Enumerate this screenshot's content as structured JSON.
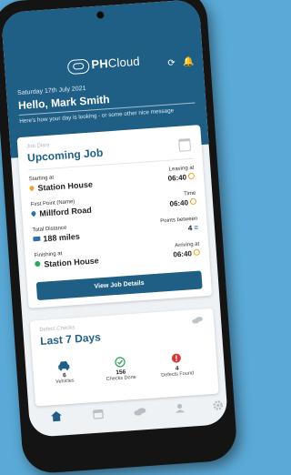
{
  "app": {
    "logo_ph": "PH",
    "logo_cloud": "Cloud"
  },
  "header": {
    "date": "Saturday 17th July 2021",
    "greeting": "Hello, Mark Smith",
    "subtitle": "Here's how your day is looking - or some other nice message",
    "icons": [
      "refresh-icon",
      "bell-icon"
    ]
  },
  "job_card": {
    "kicker": "Job Diary",
    "title": "Upcoming Job",
    "starting_label": "Starting at",
    "starting_value": "Station House",
    "leaving_label": "Leaving at",
    "leaving_value": "06:40",
    "first_point_label": "First Point (Name)",
    "first_point_value": "Millford Road",
    "time_label": "Time",
    "time_value": "06:40",
    "distance_label": "Total Distance",
    "distance_value": "188 miles",
    "points_label": "Points between",
    "points_value": "4",
    "finishing_label": "Finishing at",
    "finishing_value": "Station House",
    "arriving_label": "Arriving at",
    "arriving_value": "06:40",
    "button_label": "View Job Details"
  },
  "defect_card": {
    "kicker": "Defect Checks",
    "title": "Last 7 Days",
    "stats": [
      {
        "value": "6",
        "label": "Vehicles",
        "icon": "car-icon",
        "color": "#1f5f86"
      },
      {
        "value": "156",
        "label": "Checks Done",
        "icon": "check-circle-icon",
        "color": "#2fa85a"
      },
      {
        "value": "4",
        "label": "Defects Found",
        "icon": "warning-icon",
        "color": "#d93838"
      }
    ]
  },
  "nav": {
    "items": [
      "home-icon",
      "calendar-icon",
      "defects-icon",
      "user-icon",
      "gear-icon"
    ]
  },
  "colors": {
    "brand": "#1f5f86",
    "accent": "#f0a02a",
    "background": "#5aa9d6"
  }
}
